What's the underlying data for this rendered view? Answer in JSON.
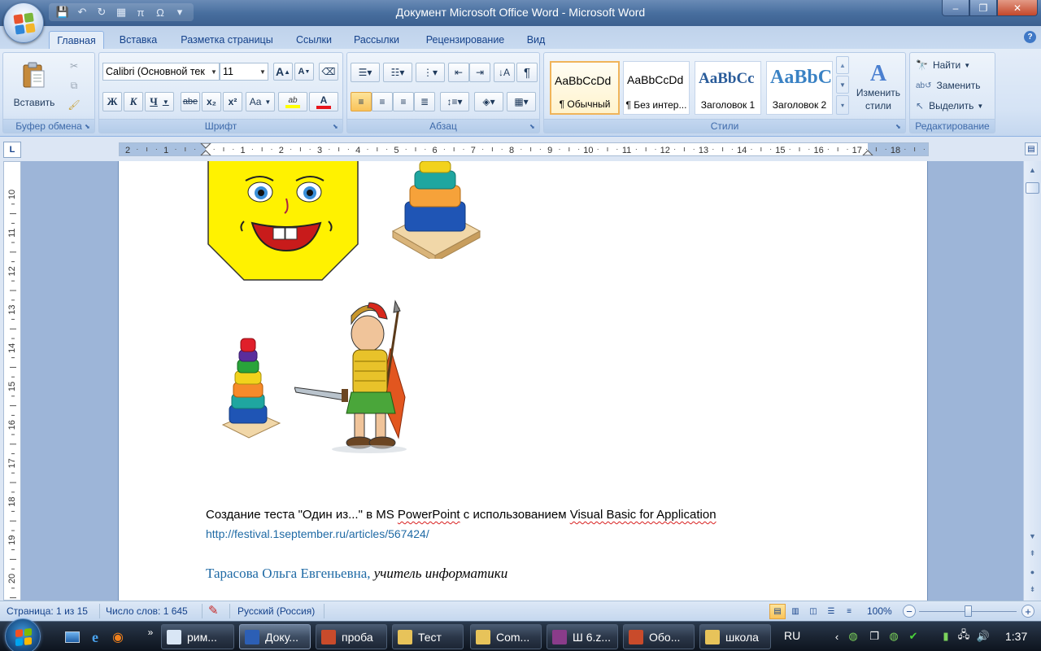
{
  "window": {
    "title": "Документ Microsoft Office Word - Microsoft Word",
    "controls": {
      "minimize": "–",
      "restore": "❐",
      "close": "✕"
    }
  },
  "qat": {
    "icons": [
      "save-icon",
      "undo-icon",
      "redo-icon",
      "table-icon",
      "pi-symbol-icon",
      "omega-symbol-icon",
      "customize-icon"
    ],
    "glyphs": [
      "💾",
      "↶",
      "↻",
      "▦",
      "π",
      "Ω",
      "▾"
    ]
  },
  "tabs": [
    "Главная",
    "Вставка",
    "Разметка страницы",
    "Ссылки",
    "Рассылки",
    "Рецензирование",
    "Вид"
  ],
  "ribbon": {
    "clipboard": {
      "label": "Буфер обмена",
      "paste": "Вставить"
    },
    "font": {
      "label": "Шрифт",
      "family": "Calibri (Основной тек",
      "size": "11",
      "grow": "A",
      "shrink": "A",
      "bold": "Ж",
      "italic": "К",
      "underline": "Ч",
      "strike": "abe",
      "subscript": "x₂",
      "superscript": "x²",
      "case": "Aa",
      "highlight_color": "#ffff00",
      "font_color": "#e8151b"
    },
    "paragraph": {
      "label": "Абзац",
      "pilcrow": "¶"
    },
    "styles": {
      "label": "Стили",
      "items": [
        {
          "preview": "AaBbCcDd",
          "name": "¶ Обычный"
        },
        {
          "preview": "AaBbCcDd",
          "name": "¶ Без интер..."
        },
        {
          "preview": "AaBbCc",
          "name": "Заголовок 1"
        },
        {
          "preview": "AaBbC",
          "name": "Заголовок 2"
        }
      ],
      "change": "Изменить стили"
    },
    "editing": {
      "label": "Редактирование",
      "find": "Найти",
      "replace": "Заменить",
      "select": "Выделить"
    }
  },
  "ruler": {
    "corner": "L",
    "h_ticks": [
      "2",
      "1",
      "",
      "1",
      "2",
      "3",
      "4",
      "5",
      "6",
      "7",
      "8",
      "9",
      "10",
      "11",
      "12",
      "13",
      "14",
      "15",
      "16",
      "17",
      "18"
    ],
    "v_ticks": [
      "10",
      "11",
      "12",
      "13",
      "14",
      "15",
      "16",
      "17",
      "18",
      "19",
      "20"
    ]
  },
  "document": {
    "caption_parts": [
      "Создание теста \"Один из...\" в MS ",
      "PowerPoint",
      " с использованием ",
      "Visual Basic for Application"
    ],
    "link": "http://festival.1september.ru/articles/567424/",
    "author": "Тарасова Ольга Евгеньевна,",
    "role": " учитель информатики"
  },
  "status": {
    "page": "Страница: 1 из 15",
    "words": "Число слов: 1 645",
    "language": "Русский (Россия)",
    "zoom": "100%",
    "zoom_minus": "−",
    "zoom_plus": "+",
    "zoom_fraction": 0.5
  },
  "taskbar": {
    "buttons": [
      {
        "label": "рим...",
        "icon_color": "#d9e6f5"
      },
      {
        "label": "Доку...",
        "icon_color": "#2c5fb5"
      },
      {
        "label": "проба",
        "icon_color": "#c94b2b"
      },
      {
        "label": "Тест",
        "icon_color": "#e7c35a"
      },
      {
        "label": "Com...",
        "icon_color": "#e7c35a"
      },
      {
        "label": "Ш 6.z...",
        "icon_color": "#8a3c8a"
      },
      {
        "label": "Обо...",
        "icon_color": "#c94b2b"
      },
      {
        "label": "школа",
        "icon_color": "#e7c35a"
      }
    ],
    "language": "RU",
    "clock": "1:37"
  }
}
